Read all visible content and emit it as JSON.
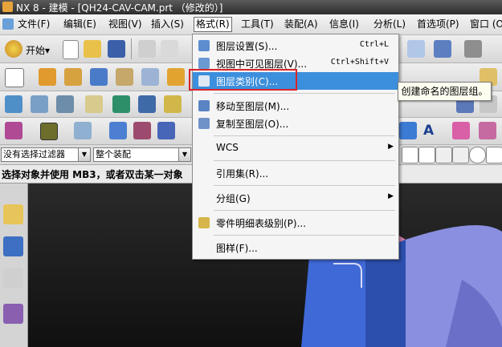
{
  "window": {
    "title": "NX 8 - 建模 - [QH24-CAV-CAM.prt （修改的）]"
  },
  "menubar": {
    "items": [
      {
        "label": "文件(F)"
      },
      {
        "label": "编辑(E)"
      },
      {
        "label": "视图(V)"
      },
      {
        "label": "插入(S)"
      },
      {
        "label": "格式(R)"
      },
      {
        "label": "工具(T)"
      },
      {
        "label": "装配(A)"
      },
      {
        "label": "信息(I)"
      },
      {
        "label": "分析(L)"
      },
      {
        "label": "首选项(P)"
      },
      {
        "label": "窗口 (O)"
      }
    ]
  },
  "toolbar": {
    "start_label": "开始▾",
    "text_tool_label": "A"
  },
  "filter": {
    "type_filter": "没有选择过滤器",
    "scope": "整个装配"
  },
  "status": {
    "prompt": "选择对象并使用 MB3，或者双击某一对象"
  },
  "format_menu": {
    "items": [
      {
        "label": "图层设置(S)...",
        "shortcut": "Ctrl+L",
        "icon": "layer-settings-icon"
      },
      {
        "label": "视图中可见图层(V)...",
        "shortcut": "Ctrl+Shift+V",
        "icon": "visible-layers-icon"
      },
      {
        "label": "图层类别(C)...",
        "shortcut": "",
        "icon": "layer-category-icon"
      },
      {
        "label": "移动至图层(M)...",
        "shortcut": "",
        "icon": "move-to-layer-icon"
      },
      {
        "label": "复制至图层(O)...",
        "shortcut": "",
        "icon": "copy-to-layer-icon"
      },
      {
        "label": "WCS",
        "shortcut": "",
        "icon": ""
      },
      {
        "label": "引用集(R)...",
        "shortcut": "",
        "icon": ""
      },
      {
        "label": "分组(G)",
        "shortcut": "",
        "icon": ""
      },
      {
        "label": "零件明细表级别(P)...",
        "shortcut": "",
        "icon": "parts-list-level-icon"
      },
      {
        "label": "图样(F)...",
        "shortcut": "",
        "icon": ""
      }
    ],
    "highlighted_index": 2
  },
  "tooltip": {
    "text": "创建命名的图层组。"
  },
  "colors": {
    "highlight": "#3c8fdc",
    "callout_border": "#d8262b",
    "model_blue": "#3f69d6"
  }
}
